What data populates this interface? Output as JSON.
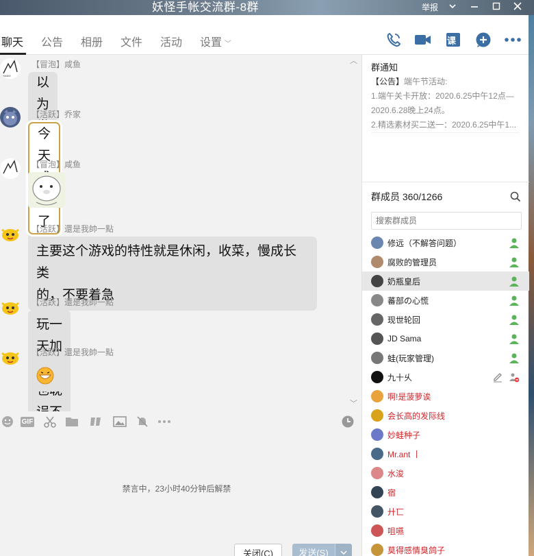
{
  "window": {
    "title": "妖怪手帐交流群-8群",
    "report": "举报"
  },
  "tabs": [
    {
      "label": "聊天",
      "active": true
    },
    {
      "label": "公告"
    },
    {
      "label": "相册"
    },
    {
      "label": "文件"
    },
    {
      "label": "活动"
    },
    {
      "label": "设置",
      "has_caret": true
    }
  ],
  "header_icons": [
    "phone-icon",
    "video-icon",
    "lesson-icon",
    "add-app-icon",
    "more-icon"
  ],
  "header_lesson_glyph": "课",
  "messages": [
    {
      "meta": "【冒泡】咸鱼",
      "text": "以为世界都要围着他转",
      "kind": "text"
    },
    {
      "meta": "【活跃】乔家",
      "text": "今天成长了",
      "kind": "framed"
    },
    {
      "meta": "【冒泡】咸鱼",
      "kind": "sticker"
    },
    {
      "meta": "【活跃】還是我帥一點",
      "lines": [
        "主要这个游戏的特性就是休闲，收菜，慢成长类",
        "的，不要着急"
      ],
      "kind": "multiline"
    },
    {
      "meta": "【活跃】還是我帥一點",
      "text": "玩一天加群，也耽误不了什么",
      "kind": "text"
    },
    {
      "meta": "【活跃】還是我帥一點",
      "kind": "emoji"
    }
  ],
  "toolbar": {
    "icons": [
      "emoji-icon",
      "gif-icon",
      "scissors-icon",
      "folder-icon",
      "music-icon",
      "image-icon",
      "mute-bell-icon",
      "more-icon",
      "history-clock-icon"
    ],
    "gif_label": "GIF"
  },
  "input": {
    "muted_notice": "禁言中，23小时40分钟后解禁",
    "close_label": "关闭(C)",
    "send_label": "发送(S)"
  },
  "notice": {
    "title": "群通知",
    "tag": "【公告】",
    "headline": "端午节活动:",
    "lines": [
      "1.端午关卡开放：2020.6.25中午12点—",
      "2020.6.28晚上24点。",
      "2.精选素材买二送一：2020.6.25中午1..."
    ]
  },
  "members": {
    "title": "群成员 360/1266",
    "search_placeholder": "搜索群成员",
    "list": [
      {
        "name": "修远（不解答问题）",
        "admin": true,
        "color": "normal"
      },
      {
        "name": "腐败的管理员",
        "admin": true,
        "color": "normal"
      },
      {
        "name": "奶瓶皇后",
        "admin": true,
        "color": "normal",
        "selected": true
      },
      {
        "name": "蕃部の心慌",
        "admin": true,
        "color": "normal"
      },
      {
        "name": "现世轮回",
        "admin": true,
        "color": "normal"
      },
      {
        "name": "JD Sama",
        "admin": true,
        "color": "normal"
      },
      {
        "name": "蛙(玩家管理)",
        "admin": true,
        "color": "normal"
      },
      {
        "name": "九十乆",
        "admin": false,
        "owner_tools": true,
        "color": "normal"
      },
      {
        "name": "啊!是菠萝诶",
        "admin": false,
        "color": "red"
      },
      {
        "name": "会长高的发际线",
        "admin": false,
        "color": "red"
      },
      {
        "name": "妙蛙种子",
        "admin": false,
        "color": "red"
      },
      {
        "name": "Mr.ant 丨",
        "admin": false,
        "color": "red"
      },
      {
        "name": "水浚",
        "admin": false,
        "color": "red"
      },
      {
        "name": "宿",
        "admin": false,
        "color": "red"
      },
      {
        "name": "廾匸",
        "admin": false,
        "color": "red"
      },
      {
        "name": "咀嚥",
        "admin": false,
        "color": "red"
      },
      {
        "name": "莫得感情臭鸽子",
        "admin": false,
        "color": "red"
      }
    ]
  },
  "colors": {
    "accent_blue": "#3b6ea5",
    "name_red": "#d0262b",
    "admin_green": "#5bb35b"
  }
}
